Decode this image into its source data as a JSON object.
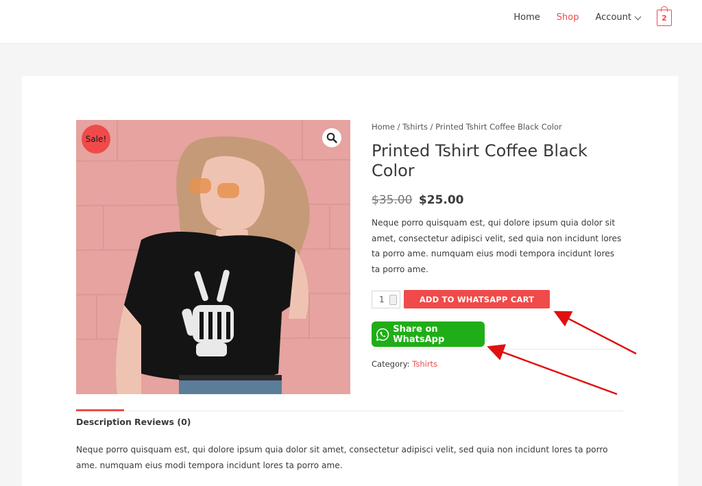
{
  "header": {
    "nav": [
      "Home",
      "Shop",
      "Account"
    ],
    "active": "Shop",
    "cart_count": "2"
  },
  "product": {
    "sale_badge": "Sale!",
    "breadcrumb": [
      "Home",
      "Tshirts",
      "Printed Tshirt Coffee Black Color"
    ],
    "breadcrumb_sep": " / ",
    "title": "Printed Tshirt Coffee Black Color",
    "price_old": "$35.00",
    "price_new": "$25.00",
    "short_description": "Neque porro quisquam est, qui dolore ipsum quia dolor sit amet, consectetur adipisci velit, sed quia non incidunt lores ta porro ame. numquam eius modi tempora incidunt lores ta porro ame.",
    "quantity": "1",
    "add_to_cart": "ADD TO WHATSAPP CART",
    "share_whatsapp": "Share on WhatsApp",
    "category_label": "Category:",
    "category_value": "Tshirts"
  },
  "tabs": {
    "items": [
      "Description",
      "Reviews (0)"
    ],
    "active": "Description",
    "description": "Neque porro quisquam est, qui dolore ipsum quia dolor sit amet, consectetur adipisci velit, sed quia non incidunt lores ta porro ame. numquam eius modi tempora incidunt lores ta porro ame."
  },
  "colors": {
    "accent": "#f04a4a",
    "whatsapp": "#1fae17",
    "annotation_arrow": "#e01010"
  }
}
